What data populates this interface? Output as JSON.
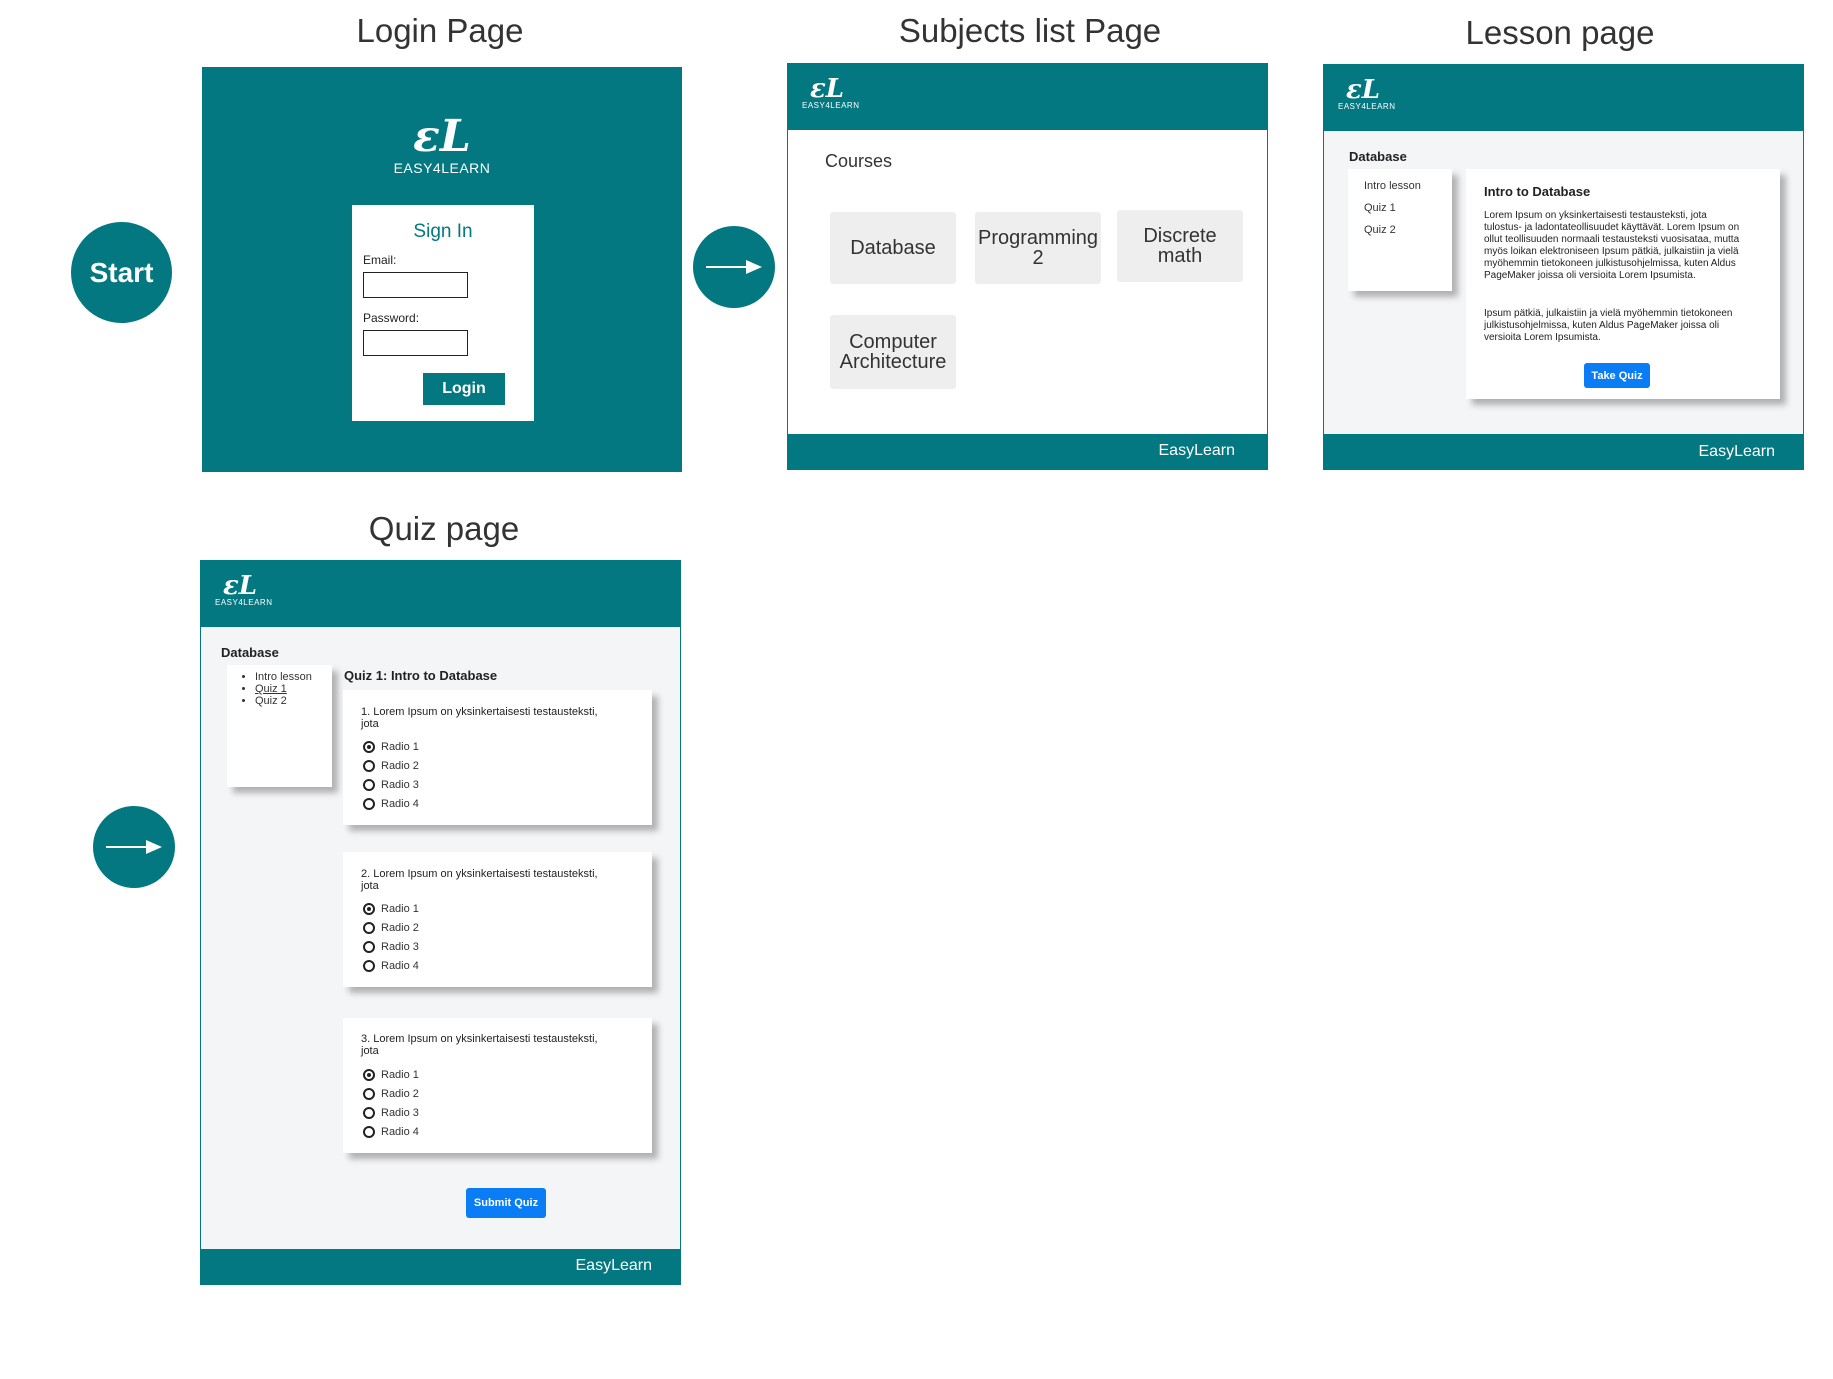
{
  "titles": {
    "login": "Login Page",
    "subjects": "Subjects list Page",
    "lesson": "Lesson page",
    "quiz": "Quiz page"
  },
  "flow": {
    "start_label": "Start"
  },
  "logo": {
    "mark": "εL",
    "word": "EASY4LEARN"
  },
  "login": {
    "heading": "Sign In",
    "email_label": "Email:",
    "password_label": "Password:",
    "email_value": "",
    "password_value": "",
    "button": "Login"
  },
  "subjects": {
    "courses_label": "Courses",
    "courses": [
      "Database",
      "Programming 2",
      "Discrete math",
      "Computer Architecture"
    ],
    "footer": "EasyLearn"
  },
  "lesson": {
    "section": "Database",
    "nav": [
      "Intro lesson",
      "Quiz 1",
      "Quiz 2"
    ],
    "card_title": "Intro to Database",
    "paragraph1": "Lorem Ipsum on yksinkertaisesti testausteksti, jota tulostus- ja ladontateollisuudet käyttävät. Lorem Ipsum on ollut teollisuuden normaali testausteksti vuosisataa, mutta myös loikan elektroniseen Ipsum pätkiä, julkaistiin ja vielä myöhemmin tietokoneen julkistusohjelmissa, kuten Aldus PageMaker joissa oli versioita Lorem Ipsumista.",
    "paragraph2": "Ipsum pätkiä, julkaistiin ja vielä myöhemmin tietokoneen julkistusohjelmissa, kuten Aldus PageMaker joissa oli versioita Lorem Ipsumista.",
    "button": "Take Quiz",
    "footer": "EasyLearn"
  },
  "quiz": {
    "section": "Database",
    "nav": [
      "Intro lesson",
      "Quiz 1",
      "Quiz 2"
    ],
    "title": "Quiz 1: Intro to Database",
    "questions": [
      {
        "text": "1. Lorem Ipsum on yksinkertaisesti testausteksti, jota",
        "options": [
          "Radio 1",
          "Radio 2",
          "Radio 3",
          "Radio 4"
        ],
        "selected": 0
      },
      {
        "text": "2. Lorem Ipsum on yksinkertaisesti testausteksti, jota",
        "options": [
          "Radio 1",
          "Radio 2",
          "Radio 3",
          "Radio 4"
        ],
        "selected": 0
      },
      {
        "text": "3. Lorem Ipsum on yksinkertaisesti testausteksti, jota",
        "options": [
          "Radio 1",
          "Radio 2",
          "Radio 3",
          "Radio 4"
        ],
        "selected": 0
      }
    ],
    "button": "Submit Quiz",
    "footer": "EasyLearn"
  },
  "colors": {
    "teal": "#037880",
    "blue_button": "#0a7cf5",
    "course_tile": "#eeeeee",
    "page_bg": "#f4f5f7"
  }
}
